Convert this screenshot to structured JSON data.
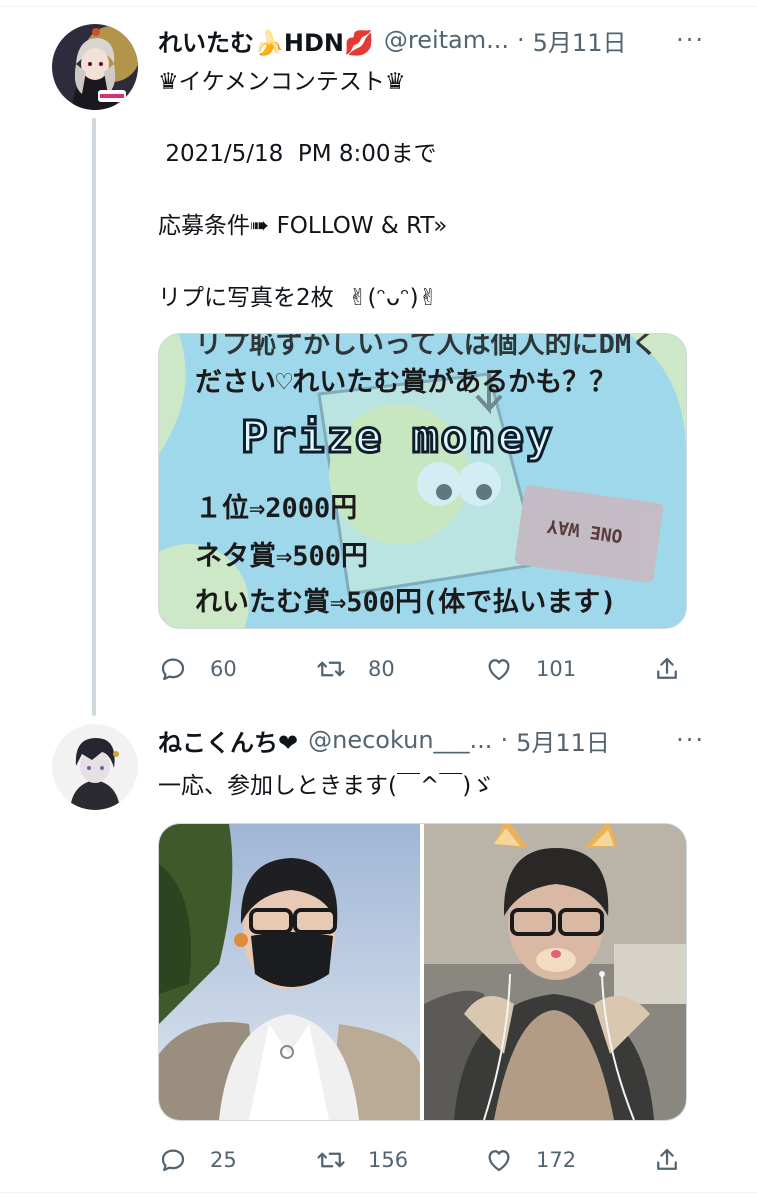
{
  "tweets": [
    {
      "name": "れいたむ🍌HDN💋",
      "handle": "@reitam...",
      "sep": "·",
      "date": "5月11日",
      "more": "···",
      "text": "♛イケメンコンテスト♛\n\n 2021/5/18  PM 8:00まで\n\n応募条件➠ FOLLOW & RT»\n\nリプに写真を2枚  ✌(ᵔᴗᵔ)✌",
      "image_text": {
        "top_partial": "リプ恥ずかしいって人は個人的にDMく",
        "line2": "ださい♡れいたむ賞があるかも？？",
        "title": "Prize money",
        "first": "１位⇒2000円",
        "neta": "ネタ賞⇒500円",
        "reitam": "れいたむ賞⇒500円(体で払います)",
        "stamp": "ONE WAY"
      },
      "replies": "60",
      "retweets": "80",
      "likes": "101"
    },
    {
      "name": "ねこくんち❤",
      "handle": "@necokun___...",
      "sep": "·",
      "date": "5月11日",
      "more": "···",
      "text": "一応、参加しときます(￣^￣)ゞ",
      "replies": "25",
      "retweets": "156",
      "likes": "172"
    }
  ],
  "colors": {
    "text": "#0f1419",
    "secondary": "#536471",
    "border": "#cfd9de",
    "thread": "#cfd9de",
    "prize_bg": "#9fd8ea"
  },
  "icons": [
    "reply-icon",
    "retweet-icon",
    "like-icon",
    "share-icon",
    "more-icon"
  ]
}
